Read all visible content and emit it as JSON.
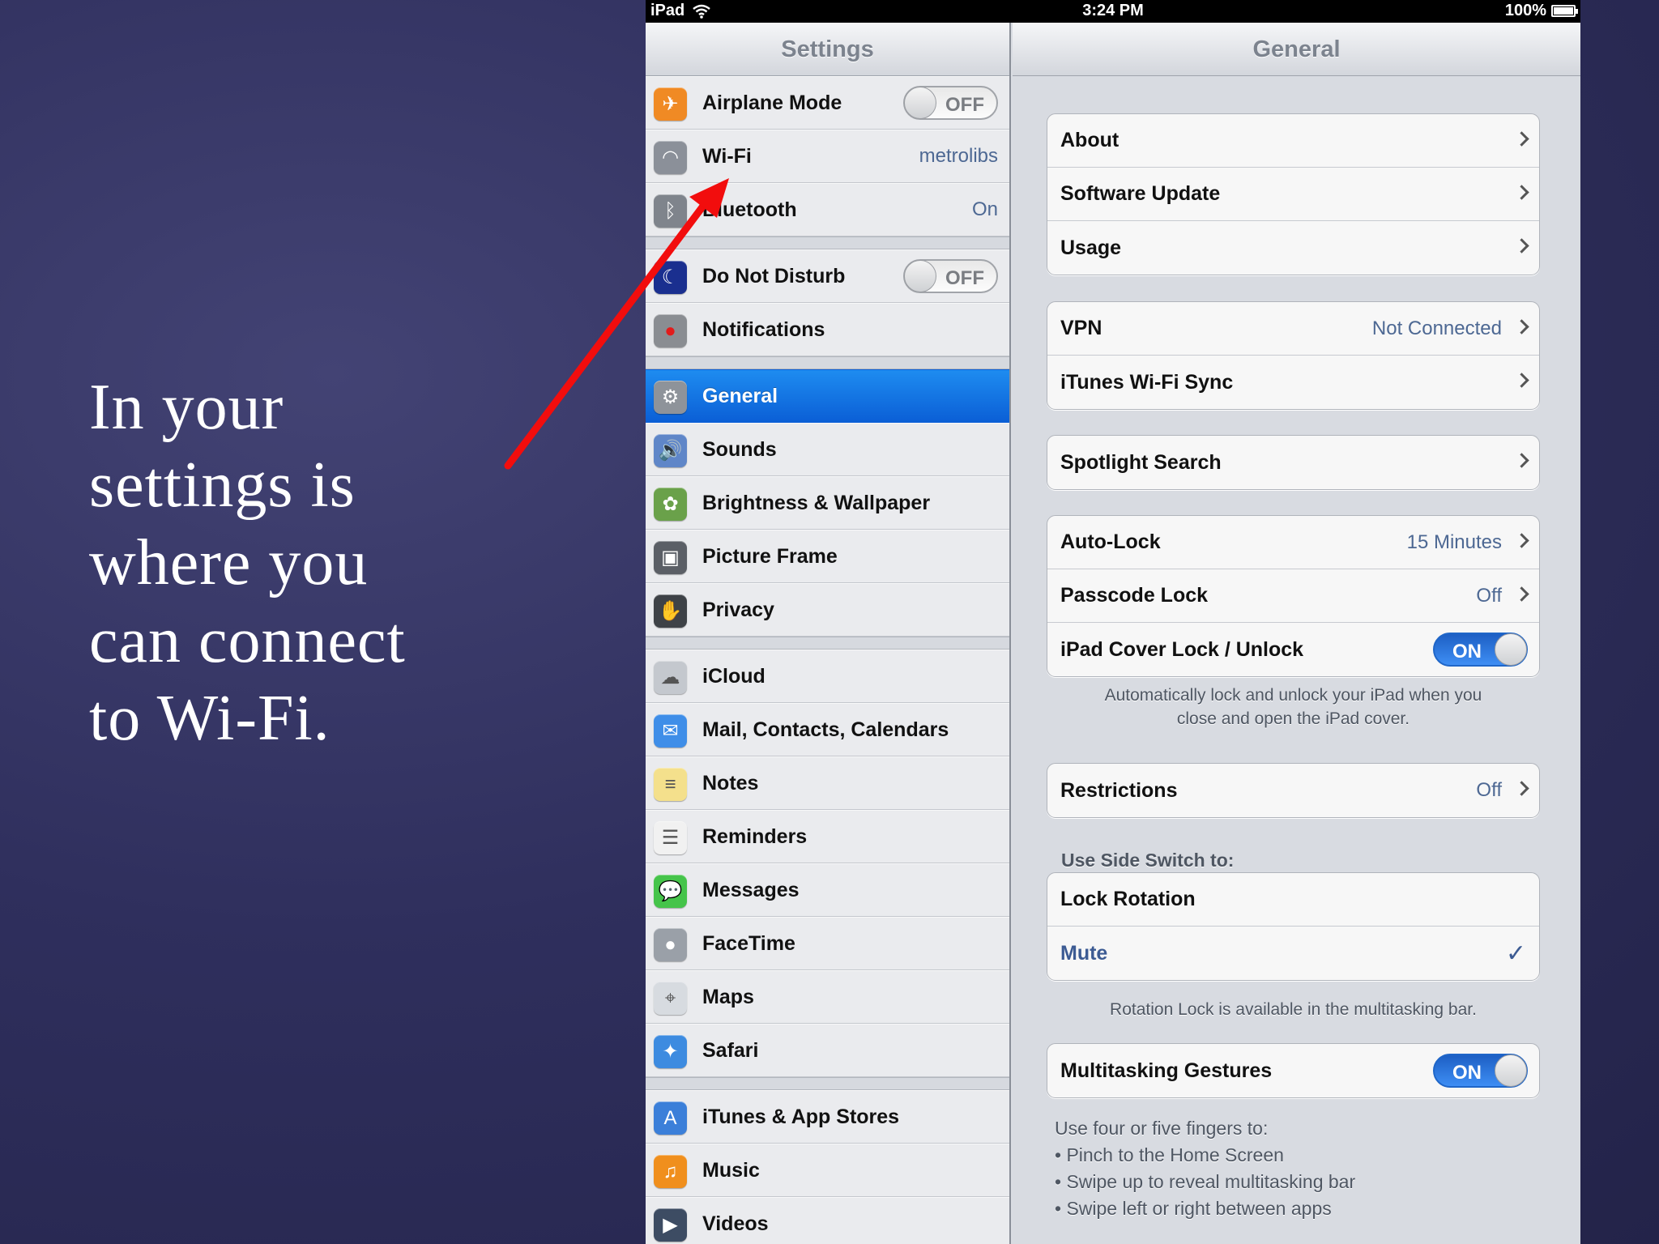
{
  "slide": {
    "lines": [
      "In your",
      "settings is",
      "where you",
      "can connect",
      "to Wi-Fi."
    ]
  },
  "statusbar": {
    "device": "iPad",
    "time": "3:24 PM",
    "battery": "100%"
  },
  "master": {
    "title": "Settings",
    "groups": [
      [
        {
          "label": "Airplane Mode",
          "icon": "airplane-icon",
          "switch": "OFF",
          "color": "#f08a24"
        },
        {
          "label": "Wi-Fi",
          "icon": "wifi-icon",
          "value": "metrolibs",
          "color": "#8b9099"
        },
        {
          "label": "Bluetooth",
          "icon": "bluetooth-icon",
          "value": "On",
          "color": "#7f848c"
        }
      ],
      [
        {
          "label": "Do Not Disturb",
          "icon": "moon-icon",
          "switch": "OFF",
          "color": "#1a2f8f"
        },
        {
          "label": "Notifications",
          "icon": "notifications-icon",
          "color": "#8a8d92"
        }
      ],
      [
        {
          "label": "General",
          "icon": "gear-icon",
          "selected": true,
          "color": "#8e939a"
        },
        {
          "label": "Sounds",
          "icon": "speaker-icon",
          "color": "#5f86c8"
        },
        {
          "label": "Brightness & Wallpaper",
          "icon": "flower-icon",
          "color": "#6aa14a"
        },
        {
          "label": "Picture Frame",
          "icon": "picture-frame-icon",
          "color": "#5b5f66"
        },
        {
          "label": "Privacy",
          "icon": "hand-icon",
          "color": "#3e4247"
        }
      ],
      [
        {
          "label": "iCloud",
          "icon": "cloud-icon",
          "color": "#c4c8ce"
        },
        {
          "label": "Mail, Contacts, Calendars",
          "icon": "mail-icon",
          "color": "#3f8ee8"
        },
        {
          "label": "Notes",
          "icon": "notes-icon",
          "color": "#f4e08c"
        },
        {
          "label": "Reminders",
          "icon": "reminders-icon",
          "color": "#f1f1f1"
        },
        {
          "label": "Messages",
          "icon": "messages-icon",
          "color": "#45c44a"
        },
        {
          "label": "FaceTime",
          "icon": "facetime-icon",
          "color": "#9aa0a8"
        },
        {
          "label": "Maps",
          "icon": "maps-icon",
          "color": "#d7dbe0"
        },
        {
          "label": "Safari",
          "icon": "compass-icon",
          "color": "#3d8be0"
        }
      ],
      [
        {
          "label": "iTunes & App Stores",
          "icon": "app-store-icon",
          "color": "#3b7fd9"
        },
        {
          "label": "Music",
          "icon": "music-note-icon",
          "color": "#f08f1d"
        },
        {
          "label": "Videos",
          "icon": "clapper-icon",
          "color": "#3d4c63"
        }
      ]
    ]
  },
  "detail": {
    "title": "General",
    "about": "About",
    "software_update": "Software Update",
    "usage": "Usage",
    "vpn": "VPN",
    "vpn_value": "Not Connected",
    "itunes_sync": "iTunes Wi-Fi Sync",
    "spotlight": "Spotlight Search",
    "auto_lock": "Auto-Lock",
    "auto_lock_value": "15 Minutes",
    "passcode_lock": "Passcode Lock",
    "passcode_value": "Off",
    "cover_lock": "iPad Cover Lock / Unlock",
    "cover_lock_switch": "ON",
    "cover_note_1": "Automatically lock and unlock your iPad when you",
    "cover_note_2": "close and open the iPad cover.",
    "restrictions": "Restrictions",
    "restrictions_value": "Off",
    "side_switch_header": "Use Side Switch to:",
    "lock_rotation": "Lock Rotation",
    "mute": "Mute",
    "checkmark": "✓",
    "rotation_note": "Rotation Lock is available in the multitasking bar.",
    "multitasking": "Multitasking Gestures",
    "multitasking_switch": "ON",
    "gestures_intro": "Use four or five fingers to:",
    "gestures": [
      "• Pinch to the Home Screen",
      "• Swipe up to reveal multitasking bar",
      "• Swipe left or right between apps"
    ]
  },
  "colors": {
    "arrow": "#f20d0d",
    "selection": "#1a7ae8",
    "accent_value": "#4d6893"
  }
}
